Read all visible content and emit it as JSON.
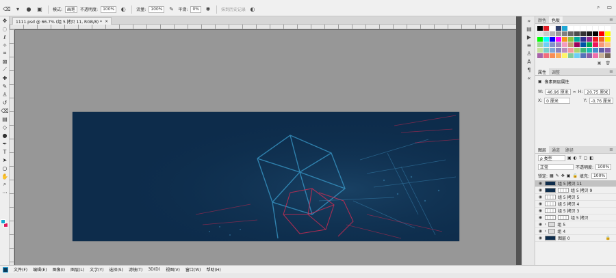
{
  "options_bar": {
    "mode_label": "模式:",
    "mode_value": "画笔",
    "opacity_label": "不透明度:",
    "opacity_value": "100%",
    "flow_label": "流量:",
    "flow_value": "100%",
    "smooth_label": "平滑:",
    "smooth_value": "0%",
    "history_label": "抹到历史记录"
  },
  "document_tab": {
    "title": "1111.psd @ 66.7% (组 5 拷贝 11, RGB/8) *",
    "close": "×"
  },
  "statusbar": {
    "menus": [
      "文件(F)",
      "编辑(E)",
      "图像(I)",
      "图层(L)",
      "文字(Y)",
      "选择(S)",
      "滤镜(T)",
      "3D(D)",
      "视图(V)",
      "窗口(W)",
      "帮助(H)"
    ]
  },
  "swatches_panel": {
    "tabs": [
      "颜色",
      "色板"
    ],
    "colors": [
      "#000000",
      "#e01b24",
      "#ffffff",
      "#2c3e6b",
      "#1fa8d6",
      "#ffffff",
      "#ffffff",
      "#ffffff",
      "#ffffff",
      "#ffffff",
      "#ffffff",
      "#ffffff",
      "#e6e6e6",
      "#cccccc",
      "#b3b3b3",
      "#999999",
      "#808080",
      "#666666",
      "#4d4d4d",
      "#333333",
      "#1a1a1a",
      "#000000",
      "#ff0000",
      "#ffff00",
      "#00ff00",
      "#00ffff",
      "#0000ff",
      "#ff00ff",
      "#f7941d",
      "#8dc63f",
      "#00a99d",
      "#2e3192",
      "#92278f",
      "#ed1c24",
      "#f26522",
      "#fff200",
      "#a3d39c",
      "#6dcff6",
      "#8393ca",
      "#a186be",
      "#f49ac1",
      "#c69c6d",
      "#9e005d",
      "#0054a6",
      "#00a651",
      "#ed145b",
      "#f7977a",
      "#fdc68a",
      "#c4df9b",
      "#7bcdc8",
      "#7ea7d8",
      "#8882be",
      "#bc8dbf",
      "#f6989d",
      "#acd373",
      "#3cb878",
      "#1cbbb4",
      "#448ccb",
      "#605ca8",
      "#855fa8",
      "#a763a8",
      "#f26d7d",
      "#f68e56",
      "#fbaf5d",
      "#fff568",
      "#82ca9c",
      "#6ecff6",
      "#5674b9",
      "#8560a8",
      "#f06eaa",
      "#c7b299",
      "#736357"
    ]
  },
  "properties_panel": {
    "tabs": [
      "属性",
      "调整"
    ],
    "title": "像素图层属性",
    "w_label": "W:",
    "w_value": "46.96 厘米",
    "h_label": "H:",
    "h_value": "20.75 厘米",
    "x_label": "X:",
    "x_value": "0 厘米",
    "y_label": "Y:",
    "y_value": "-0.76 厘米"
  },
  "layers_panel": {
    "tabs": [
      "图层",
      "通道",
      "路径"
    ],
    "filter_value": "ρ 类型",
    "blend_mode": "正常",
    "opacity_label": "不透明度:",
    "opacity_value": "100%",
    "lock_label": "锁定:",
    "fill_label": "填充:",
    "fill_value": "100%",
    "layers": [
      {
        "name": "组 5 拷贝 11",
        "type": "dark",
        "selected": true
      },
      {
        "name": "组 5 拷贝 9",
        "type": "dark-mask",
        "selected": false
      },
      {
        "name": "组 5 拷贝 5",
        "type": "checker",
        "selected": false
      },
      {
        "name": "组 5 拷贝 4",
        "type": "checker",
        "selected": false
      },
      {
        "name": "组 5 拷贝 3",
        "type": "checker",
        "selected": false
      },
      {
        "name": "组 5 拷贝",
        "type": "checker-mask",
        "selected": false
      },
      {
        "name": "组 5",
        "type": "folder",
        "selected": false
      },
      {
        "name": "组 4",
        "type": "folder",
        "selected": false
      },
      {
        "name": "图层 0",
        "type": "dark-lock",
        "selected": false
      }
    ]
  }
}
